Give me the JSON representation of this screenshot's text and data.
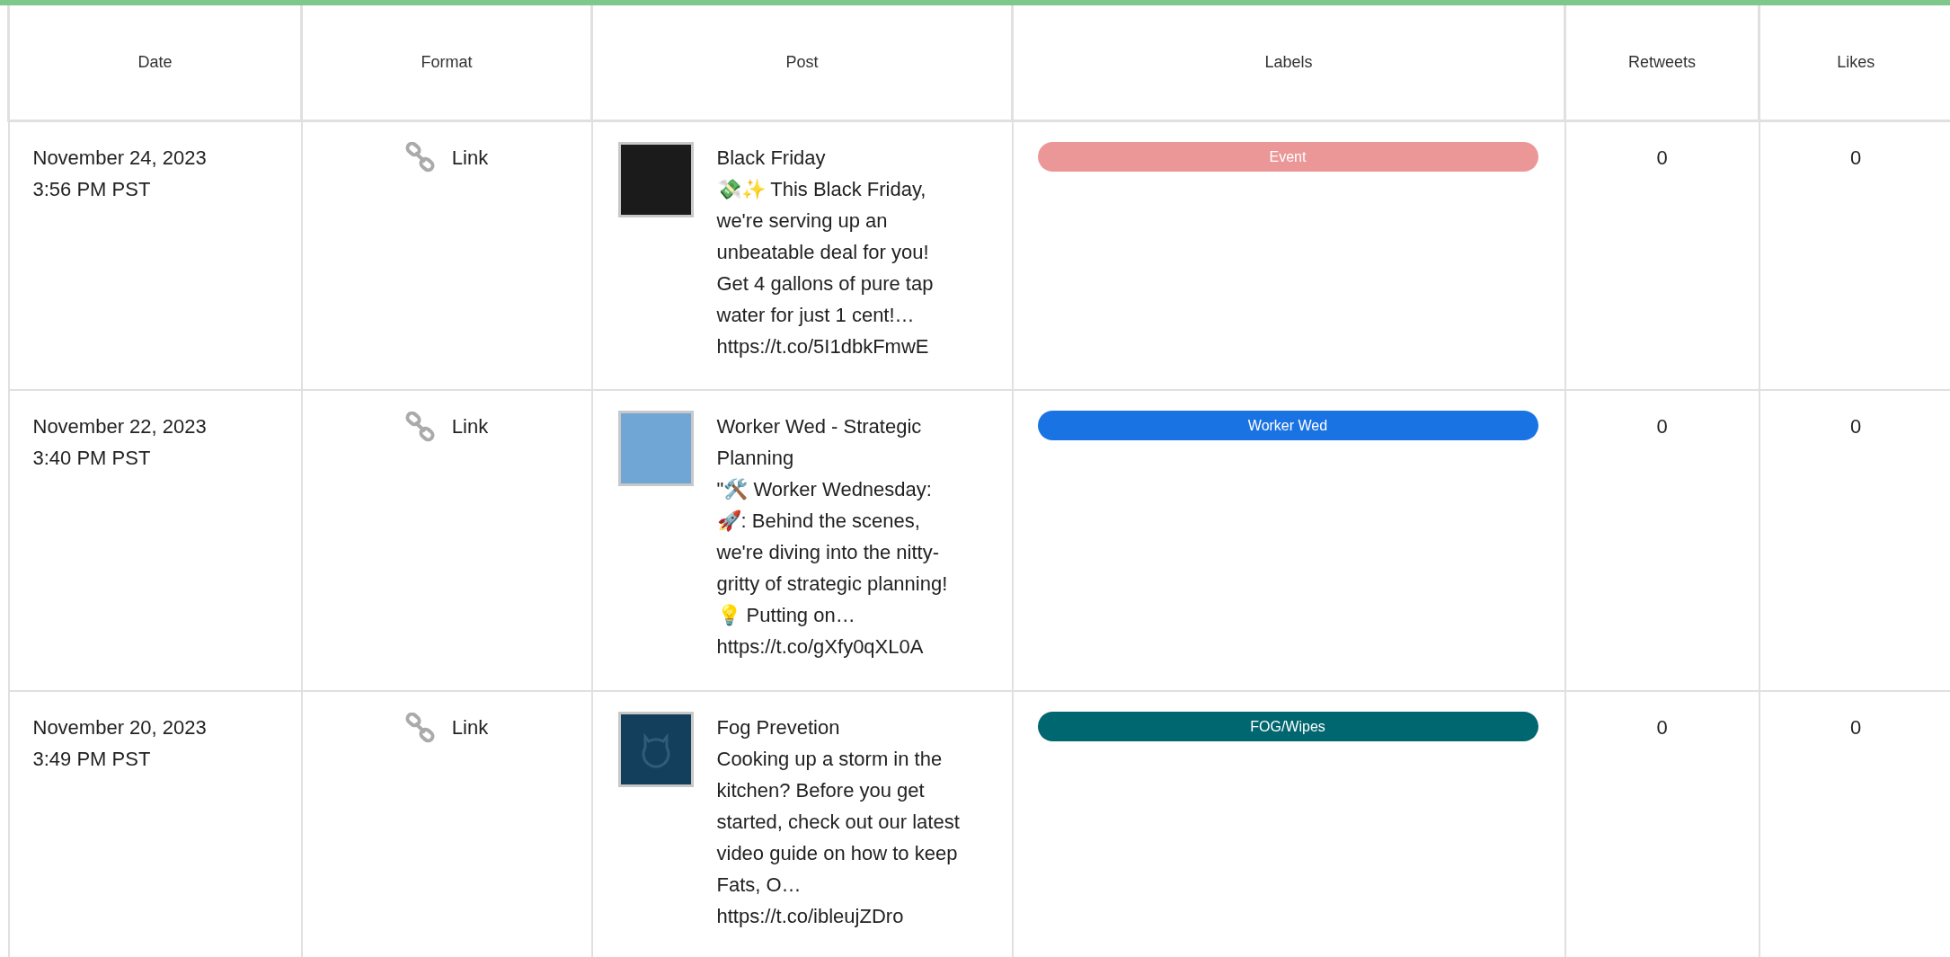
{
  "table": {
    "columns": [
      "Date",
      "Format",
      "Post",
      "Labels",
      "Retweets",
      "Likes"
    ],
    "rows": [
      {
        "date": "November 24, 2023",
        "time": "3:56 PM PST",
        "format": "Link",
        "thumbnail": {
          "kind": "photo"
        },
        "post_title": "Black Friday",
        "post_body": "💸✨ This Black Friday, we're serving up an unbeatable deal for you! Get 4 gallons of pure tap water for just 1 cent!…",
        "post_link": "https://t.co/5I1dbkFmwE",
        "label": {
          "text": "Event",
          "color": "#ec9797"
        },
        "retweets": "0",
        "likes": "0"
      },
      {
        "date": "November 22, 2023",
        "time": "3:40 PM PST",
        "format": "Link",
        "thumbnail": {
          "kind": "photo"
        },
        "post_title": "Worker Wed - Strategic Planning",
        "post_body": "\"🛠️ Worker Wednesday: 🚀: Behind the scenes, we're diving into the nitty-gritty of strategic planning! 💡 Putting on…",
        "post_link": "https://t.co/gXfy0qXL0A",
        "label": {
          "text": "Worker Wed",
          "color": "#1a73e3"
        },
        "retweets": "0",
        "likes": "0"
      },
      {
        "date": "November 20, 2023",
        "time": "3:49 PM PST",
        "format": "Link",
        "thumbnail": {
          "kind": "placeholder"
        },
        "post_title": "Fog Prevetion",
        "post_body": "Cooking up a storm in the kitchen? Before you get started, check out our latest video guide on how to keep Fats, O…",
        "post_link": "https://t.co/ibleujZDro",
        "label": {
          "text": "FOG/Wipes",
          "color": "#00666f"
        },
        "retweets": "0",
        "likes": "0"
      }
    ]
  }
}
